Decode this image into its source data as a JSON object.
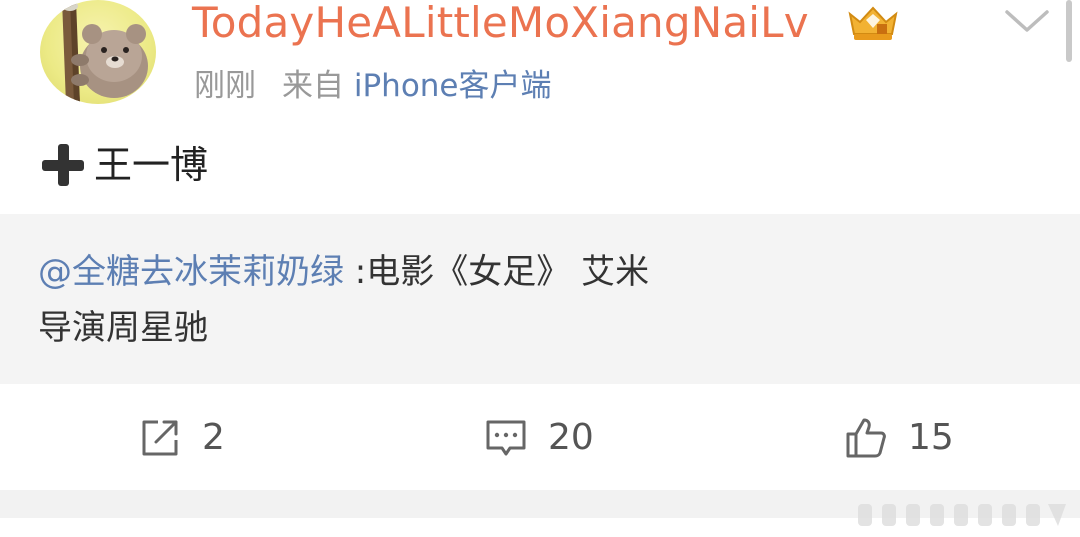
{
  "post": {
    "username": "TodayHeALittleMoXiangNaiLv",
    "time": "刚刚",
    "source_prefix": "来自",
    "source": "iPhone客户端",
    "content_text": "王一博"
  },
  "repost": {
    "mention": "@全糖去冰茉莉奶绿",
    "line1_text": " :电影《女足》 艾米",
    "line2_text": "导演周星驰"
  },
  "actions": {
    "repost_count": "2",
    "comment_count": "20",
    "like_count": "15"
  },
  "colors": {
    "username": "#eb7350",
    "link": "#5d7fb3",
    "meta": "#999999",
    "repost_bg": "#f4f4f4"
  },
  "icons": [
    "avatar-bear",
    "crown-badge-icon",
    "chevron-down-icon",
    "plus-icon",
    "repost-icon",
    "comment-icon",
    "like-icon"
  ]
}
